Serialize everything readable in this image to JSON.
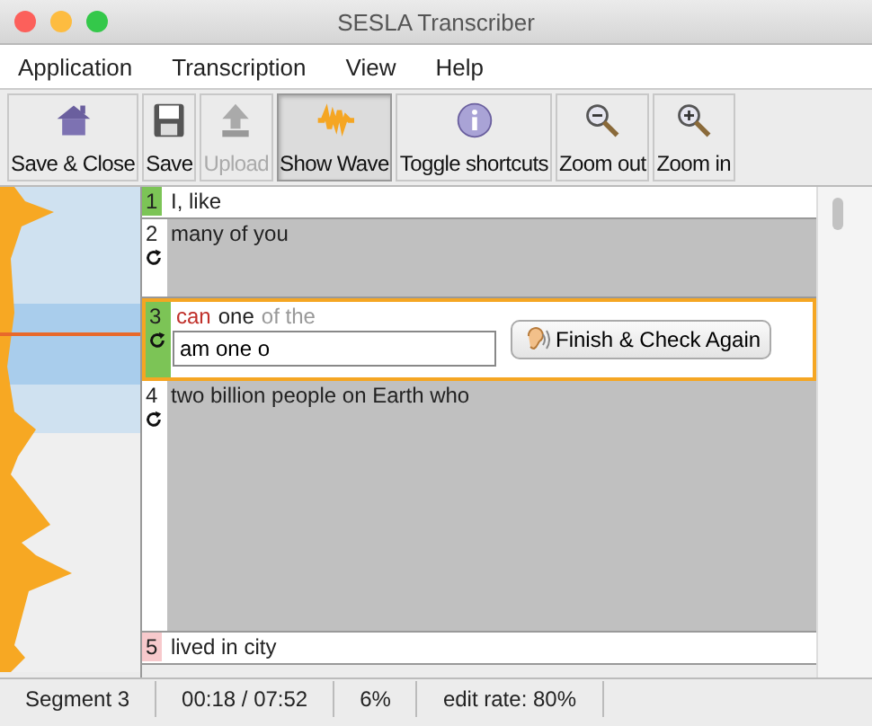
{
  "window": {
    "title": "SESLA Transcriber"
  },
  "menu": [
    "Application",
    "Transcription",
    "View",
    "Help"
  ],
  "toolbar": [
    {
      "label": "Save & Close",
      "kind": "house",
      "disabled": false,
      "selected": false
    },
    {
      "label": "Save",
      "kind": "disk",
      "disabled": false,
      "selected": false
    },
    {
      "label": "Upload",
      "kind": "upload",
      "disabled": true,
      "selected": false
    },
    {
      "label": "Show Wave",
      "kind": "wave",
      "disabled": false,
      "selected": true
    },
    {
      "label": "Toggle shortcuts",
      "kind": "info",
      "disabled": false,
      "selected": false
    },
    {
      "label": "Zoom out",
      "kind": "zoomout",
      "disabled": false,
      "selected": false
    },
    {
      "label": "Zoom in",
      "kind": "zoomin",
      "disabled": false,
      "selected": false
    }
  ],
  "segments": [
    {
      "number": "1",
      "kind": "line",
      "color": "#7cc456",
      "text": "I, like"
    },
    {
      "number": "2",
      "kind": "block",
      "text": "many of you"
    },
    {
      "number": "3",
      "kind": "editing",
      "color": "#7cc456",
      "words": [
        {
          "text": "can",
          "kind": "wrong"
        },
        {
          "text": "one",
          "kind": "correct"
        },
        {
          "text": "of the",
          "kind": "pending"
        }
      ],
      "input": {
        "value": "am one o"
      },
      "button": "Finish & Check Again"
    },
    {
      "number": "4",
      "kind": "tall",
      "text": "two billion people on Earth who"
    },
    {
      "number": "5",
      "kind": "line",
      "color": "#f7c9cc",
      "text": "lived in city"
    }
  ],
  "status_bar": [
    "Segment 3",
    "00:18 / 07:52",
    "6%",
    "edit rate: 80%"
  ]
}
